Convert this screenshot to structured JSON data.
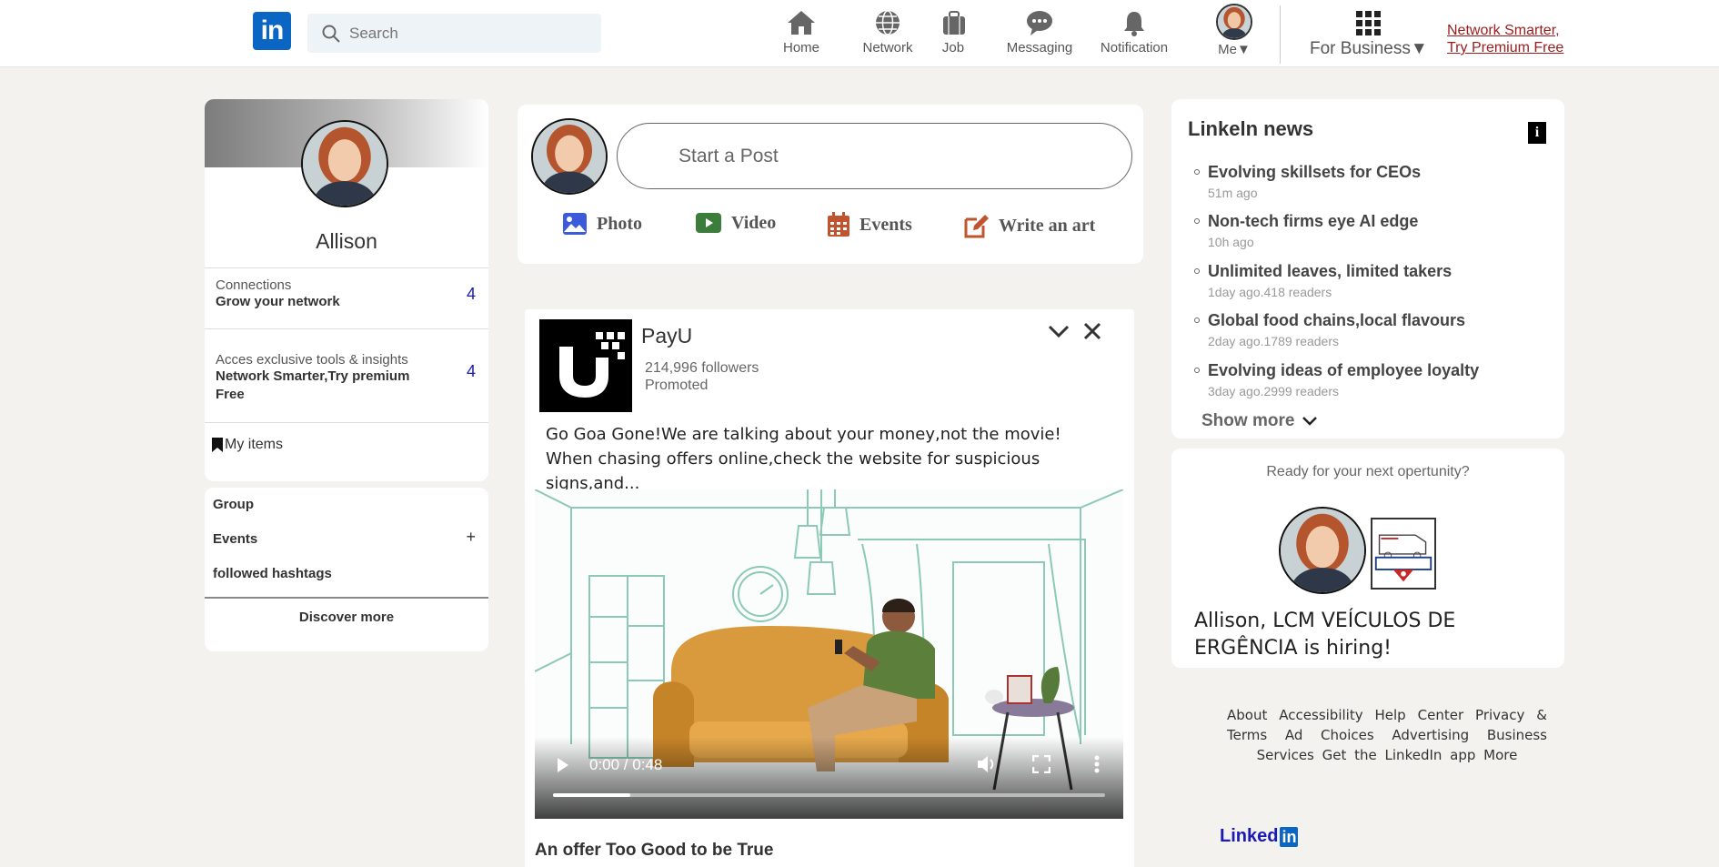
{
  "nav": {
    "logo": "in",
    "search_placeholder": "Search",
    "items": [
      {
        "label": "Home"
      },
      {
        "label": "Network"
      },
      {
        "label": "Job"
      },
      {
        "label": "Messaging"
      },
      {
        "label": "Notification"
      }
    ],
    "me_label": "Me▼",
    "for_business": "For Business▼",
    "premium_line1": "Network Smarter,",
    "premium_line2": "Try Premium Free"
  },
  "profile": {
    "name": "Allison",
    "connections_label": "Connections",
    "connections_cta": "Grow your network",
    "connections_count": "4",
    "tools_label": "Acces exclusive tools & insights",
    "tools_cta": "Network Smarter,Try premium Free",
    "tools_count": "4",
    "my_items": "My items"
  },
  "groups": {
    "group": "Group",
    "events": "Events",
    "plus": "+",
    "hashtags": "followed hashtags",
    "discover": "Discover more"
  },
  "compose": {
    "start_post": "Start a Post",
    "actions": [
      {
        "label": "Photo",
        "color": "#3b5bdb"
      },
      {
        "label": "Video",
        "color": "#3c7d3c"
      },
      {
        "label": "Events",
        "color": "#c0542f"
      },
      {
        "label": "Write an art",
        "color": "#c0542f"
      }
    ]
  },
  "ad": {
    "company": "PayU",
    "followers": "214,996 followers",
    "promoted": "Promoted",
    "text_line1": "Go Goa Gone!We are talking about your money,not the movie!",
    "text_line2": "When chasing offers online,check the website for suspicious signs,and...",
    "video_time": "0:00 / 0:48",
    "video_progress": 0.14,
    "headline": "An offer Too Good to be True"
  },
  "news": {
    "title": "Linkeln news",
    "info": "i",
    "items": [
      {
        "title": "Evolving skillsets for CEOs",
        "meta": "51m ago"
      },
      {
        "title": "Non-tech firms eye AI edge",
        "meta": "10h ago"
      },
      {
        "title": "Unlimited leaves, limited takers",
        "meta": "1day ago.418 readers"
      },
      {
        "title": "Global food chains,local flavours",
        "meta": "2day ago.1789 readers"
      },
      {
        "title": "Evolving ideas of employee loyalty",
        "meta": "3day ago.2999 readers"
      }
    ],
    "show_more": "Show more"
  },
  "hiring": {
    "ready": "Ready for your next opertunity?",
    "message": "Allison, LCM VEÍCULOS DE ERGÊNCIA is hiring!"
  },
  "footer": {
    "links": "About Accessibility Help Center Privacy & Terms Ad Choices Advertising Business Services Get the LinkedIn app More",
    "brand_text": "Linked",
    "brand_in": "in"
  }
}
